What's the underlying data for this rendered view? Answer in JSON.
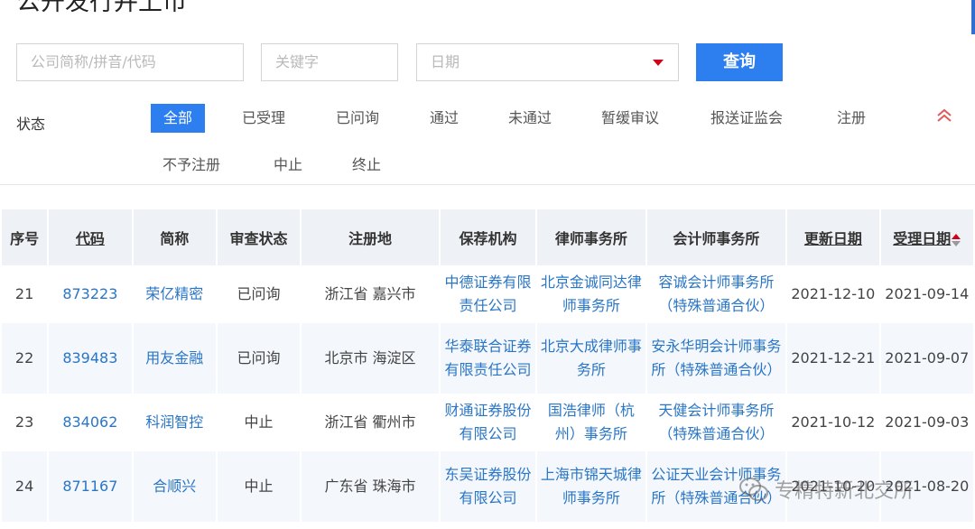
{
  "page": {
    "title": "公开发行并上市"
  },
  "search": {
    "company_placeholder": "公司简称/拼音/代码",
    "keyword_placeholder": "关键字",
    "date_placeholder": "日期",
    "query_label": "查询"
  },
  "status_filter": {
    "label": "状态",
    "options": [
      "全部",
      "已受理",
      "已问询",
      "通过",
      "未通过",
      "暂缓审议",
      "报送证监会",
      "注册",
      "不予注册",
      "中止",
      "终止"
    ],
    "selected": "全部"
  },
  "table": {
    "headers": [
      "序号",
      "代码",
      "简称",
      "审查状态",
      "注册地",
      "保荐机构",
      "律师事务所",
      "会计师事务所",
      "更新日期",
      "受理日期"
    ],
    "rows": [
      {
        "index": "21",
        "code": "873223",
        "name": "荣亿精密",
        "status": "已问询",
        "location": "浙江省 嘉兴市",
        "sponsor": "中德证券有限责任公司",
        "law_firm": "北京金诚同达律师事务所",
        "accounting_firm": "容诚会计师事务所（特殊普通合伙）",
        "updated": "2021-12-10",
        "accepted": "2021-09-14"
      },
      {
        "index": "22",
        "code": "839483",
        "name": "用友金融",
        "status": "已问询",
        "location": "北京市 海淀区",
        "sponsor": "华泰联合证券有限责任公司",
        "law_firm": "北京大成律师事务所",
        "accounting_firm": "安永华明会计师事务所（特殊普通合伙）",
        "updated": "2021-12-21",
        "accepted": "2021-09-07"
      },
      {
        "index": "23",
        "code": "834062",
        "name": "科润智控",
        "status": "中止",
        "location": "浙江省 衢州市",
        "sponsor": "财通证券股份有限公司",
        "law_firm": "国浩律师（杭州）事务所",
        "accounting_firm": "天健会计师事务所（特殊普通合伙）",
        "updated": "2021-10-12",
        "accepted": "2021-09-03"
      },
      {
        "index": "24",
        "code": "871167",
        "name": "合顺兴",
        "status": "中止",
        "location": "广东省 珠海市",
        "sponsor": "东吴证券股份有限公司",
        "law_firm": "上海市锦天城律师事务所",
        "accounting_firm": "公证天业会计师事务所（特殊普通合伙）",
        "updated": "2021-10-20",
        "accepted": "2021-08-20"
      }
    ]
  },
  "watermark": {
    "text": "专精特新北交所"
  },
  "colors": {
    "accent": "#2d7ff0",
    "link": "#2a76c6",
    "caret": "#d0021b",
    "header_bg": "#eef1f5",
    "row_alt_bg": "#f4f7fb"
  }
}
